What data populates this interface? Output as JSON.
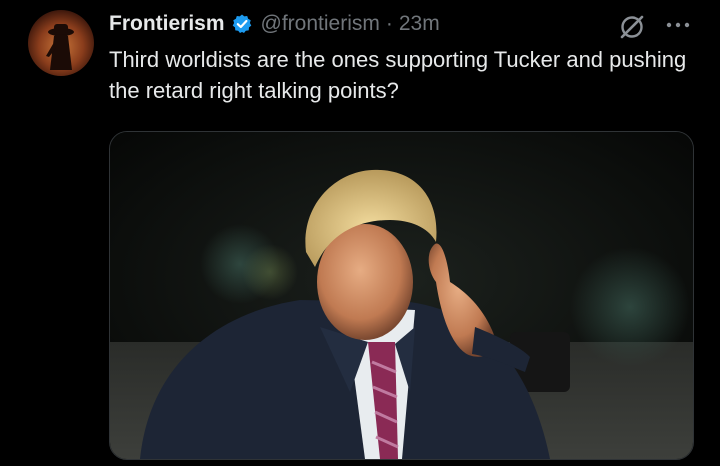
{
  "tweet": {
    "display_name": "Frontierism",
    "handle": "@frontierism",
    "separator": "·",
    "time": "23m",
    "text": "Third worldists are the ones supporting Tucker and pushing the retard right talking points?",
    "verified": true,
    "media_type": "photo"
  },
  "icons": {
    "verified": "verified-badge-icon",
    "grok": "grok-icon",
    "more": "more-options-icon"
  },
  "colors": {
    "background": "#000000",
    "text_primary": "#e7e9ea",
    "text_secondary": "#71767b",
    "verified_blue": "#1d9bf0"
  }
}
